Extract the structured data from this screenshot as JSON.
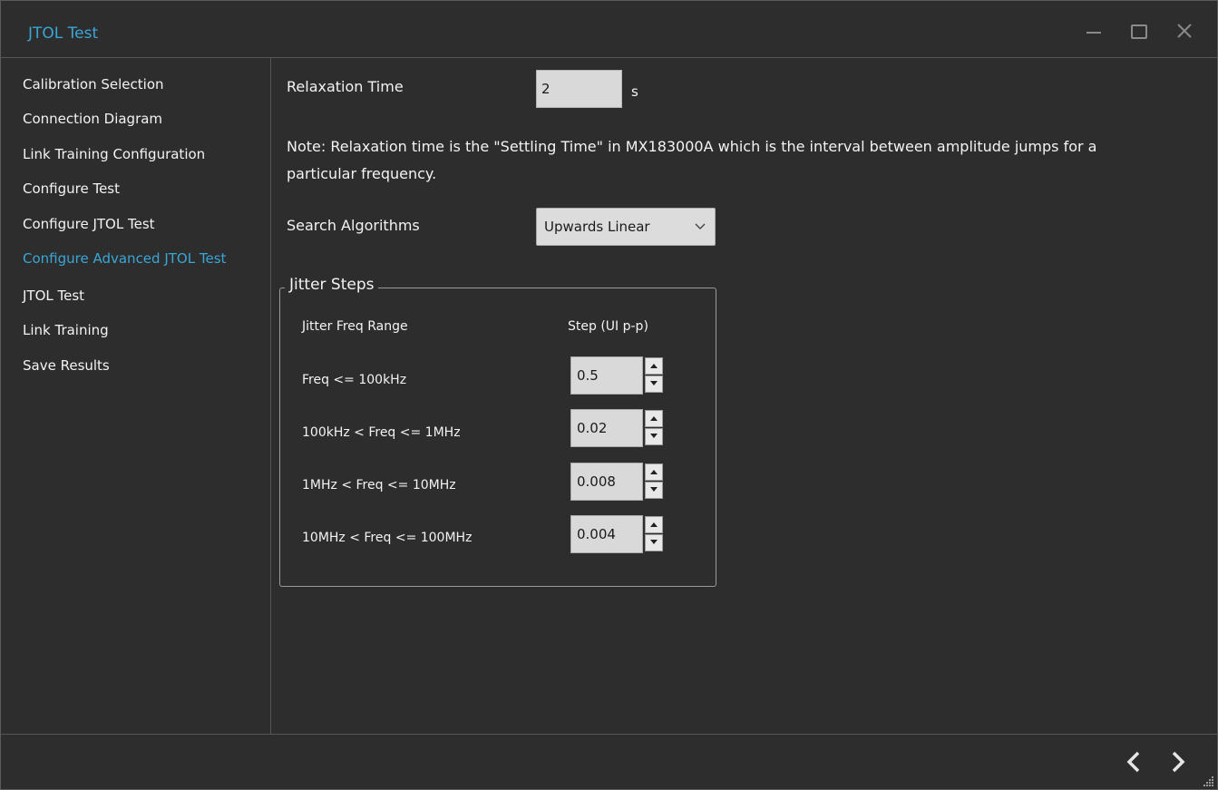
{
  "window": {
    "title": "JTOL Test"
  },
  "sidebar": {
    "items": [
      {
        "label": "Calibration Selection",
        "active": false
      },
      {
        "label": "Connection Diagram",
        "active": false
      },
      {
        "label": "Link Training Configuration",
        "active": false
      },
      {
        "label": "Configure Test",
        "active": false
      },
      {
        "label": "Configure JTOL Test",
        "active": false
      },
      {
        "label": "Configure Advanced JTOL Test",
        "active": true
      },
      {
        "label": "JTOL Test",
        "active": false
      },
      {
        "label": "Link Training",
        "active": false
      },
      {
        "label": "Save Results",
        "active": false
      }
    ]
  },
  "main": {
    "relaxation": {
      "label": "Relaxation Time",
      "value": "2",
      "unit": "s"
    },
    "note_line1": "Note: Relaxation time is the \"Settling Time\" in MX183000A which is the interval between amplitude jumps for a",
    "note_line2": "particular frequency.",
    "search": {
      "label": "Search Algorithms",
      "selected": "Upwards Linear"
    },
    "jitter_steps": {
      "title": "Jitter Steps",
      "col_range": "Jitter Freq Range",
      "col_step": "Step (UI p-p)",
      "rows": [
        {
          "range": "Freq <= 100kHz",
          "step": "0.5"
        },
        {
          "range": "100kHz < Freq <= 1MHz",
          "step": "0.02"
        },
        {
          "range": "1MHz < Freq <= 10MHz",
          "step": "0.008"
        },
        {
          "range": "10MHz < Freq <= 100MHz",
          "step": "0.004"
        }
      ]
    }
  },
  "colors": {
    "accent": "#3aa6d6",
    "background": "#2d2d2d"
  },
  "icons": [
    "minimize-icon",
    "maximize-icon",
    "close-icon",
    "chevron-down-icon",
    "chevron-left-icon",
    "chevron-right-icon",
    "resize-grip-icon"
  ]
}
